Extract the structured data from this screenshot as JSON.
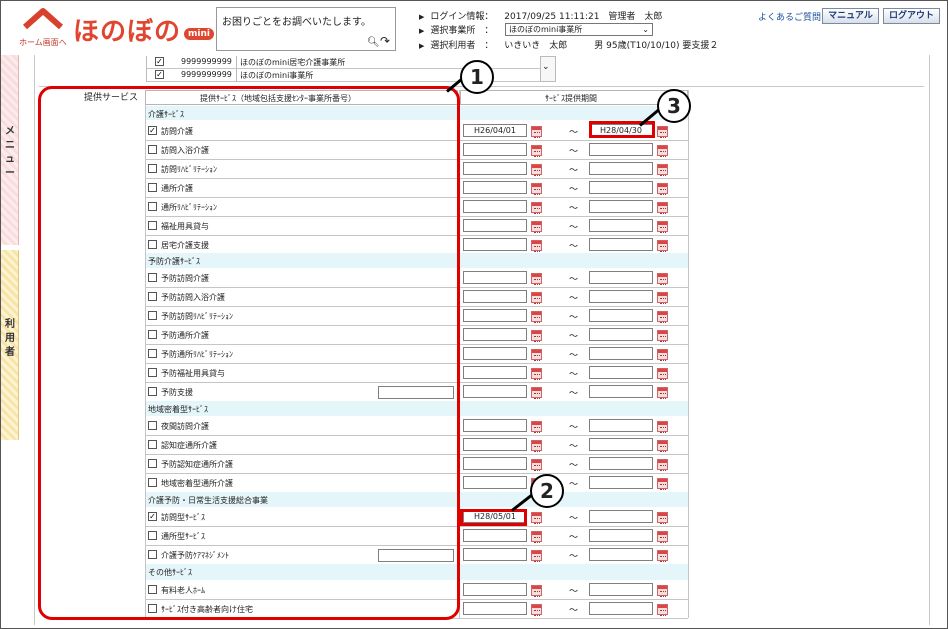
{
  "header": {
    "home_label": "ホーム画面へ",
    "logo_text": "ほのぼの",
    "logo_sub": "mini",
    "search_placeholder": "お困りごとをお調べいたします。",
    "login_label": "ログイン情報：",
    "login_value": "2017/09/25 11:11:21　管理者　太郎",
    "office_label": "選択事業所　：",
    "office_value": "ほのぼのmini事業所",
    "user_label": "選択利用者　：",
    "user_value": "いきいき　太郎　　　男 95歳(T10/10/10) 要支援２",
    "faq_link": "よくあるご質問",
    "manual_button": "マニュアル",
    "logout_button": "ログアウト"
  },
  "side_tabs": {
    "menu": "メニュー",
    "user": "利用者"
  },
  "top_rows": [
    {
      "code": "9999999999",
      "name": "ほのぼのmini居宅介護事業所"
    },
    {
      "code": "9999999999",
      "name": "ほのぼのmini事業所"
    }
  ],
  "section_label": "提供サービス",
  "table": {
    "col1_header": "提供ｻｰﾋﾞｽ（地域包括支援ｾﾝﾀｰ事業所番号）",
    "col2_header": "ｻｰﾋﾞｽ提供期間",
    "tilde": "～",
    "rows": [
      {
        "type": "cat",
        "label": "介護ｻｰﾋﾞｽ"
      },
      {
        "type": "item",
        "label": "訪問介護",
        "checked": "✓",
        "from": "H26/04/01",
        "to": "H28/04/30"
      },
      {
        "type": "item",
        "label": "訪問入浴介護",
        "checked": "",
        "from": "",
        "to": ""
      },
      {
        "type": "item",
        "label": "訪問ﾘﾊﾋﾞﾘﾃｰｼｮﾝ",
        "checked": "",
        "from": "",
        "to": ""
      },
      {
        "type": "item",
        "label": "通所介護",
        "checked": "",
        "from": "",
        "to": ""
      },
      {
        "type": "item",
        "label": "通所ﾘﾊﾋﾞﾘﾃｰｼｮﾝ",
        "checked": "",
        "from": "",
        "to": ""
      },
      {
        "type": "item",
        "label": "福祉用具貸与",
        "checked": "",
        "from": "",
        "to": ""
      },
      {
        "type": "item",
        "label": "居宅介護支援",
        "checked": "",
        "from": "",
        "to": ""
      },
      {
        "type": "cat",
        "label": "予防介護ｻｰﾋﾞｽ"
      },
      {
        "type": "item",
        "label": "予防訪問介護",
        "checked": "",
        "from": "",
        "to": ""
      },
      {
        "type": "item",
        "label": "予防訪問入浴介護",
        "checked": "",
        "from": "",
        "to": ""
      },
      {
        "type": "item",
        "label": "予防訪問ﾘﾊﾋﾞﾘﾃｰｼｮﾝ",
        "checked": "",
        "from": "",
        "to": ""
      },
      {
        "type": "item",
        "label": "予防通所介護",
        "checked": "",
        "from": "",
        "to": ""
      },
      {
        "type": "item",
        "label": "予防通所ﾘﾊﾋﾞﾘﾃｰｼｮﾝ",
        "checked": "",
        "from": "",
        "to": ""
      },
      {
        "type": "item",
        "label": "予防福祉用具貸与",
        "checked": "",
        "from": "",
        "to": ""
      },
      {
        "type": "item",
        "label": "予防支援",
        "checked": "",
        "from": "",
        "to": "",
        "extra_input": ""
      },
      {
        "type": "cat",
        "label": "地域密着型ｻｰﾋﾞｽ"
      },
      {
        "type": "item",
        "label": "夜間訪問介護",
        "checked": "",
        "from": "",
        "to": ""
      },
      {
        "type": "item",
        "label": "認知症通所介護",
        "checked": "",
        "from": "",
        "to": ""
      },
      {
        "type": "item",
        "label": "予防認知症通所介護",
        "checked": "",
        "from": "",
        "to": ""
      },
      {
        "type": "item",
        "label": "地域密着型通所介護",
        "checked": "",
        "from": "",
        "to": ""
      },
      {
        "type": "cat",
        "label": "介護予防・日常生活支援総合事業"
      },
      {
        "type": "item",
        "label": "訪問型ｻｰﾋﾞｽ",
        "checked": "✓",
        "from": "H28/05/01",
        "to": ""
      },
      {
        "type": "item",
        "label": "通所型ｻｰﾋﾞｽ",
        "checked": "",
        "from": "",
        "to": ""
      },
      {
        "type": "item",
        "label": "介護予防ｹｱﾏﾈｼﾞﾒﾝﾄ",
        "checked": "",
        "from": "",
        "to": "",
        "extra_input": ""
      },
      {
        "type": "cat",
        "label": "その他ｻｰﾋﾞｽ"
      },
      {
        "type": "item",
        "label": "有料老人ﾎｰﾑ",
        "checked": "",
        "from": "",
        "to": ""
      },
      {
        "type": "item",
        "label": "ｻｰﾋﾞｽ付き高齢者向け住宅",
        "checked": "",
        "from": "",
        "to": ""
      }
    ]
  },
  "callouts": [
    "1",
    "2",
    "3"
  ],
  "colors": {
    "accent_red": "#e00000",
    "category_bg": "#e5f6fb",
    "brand": "#e0462f"
  }
}
